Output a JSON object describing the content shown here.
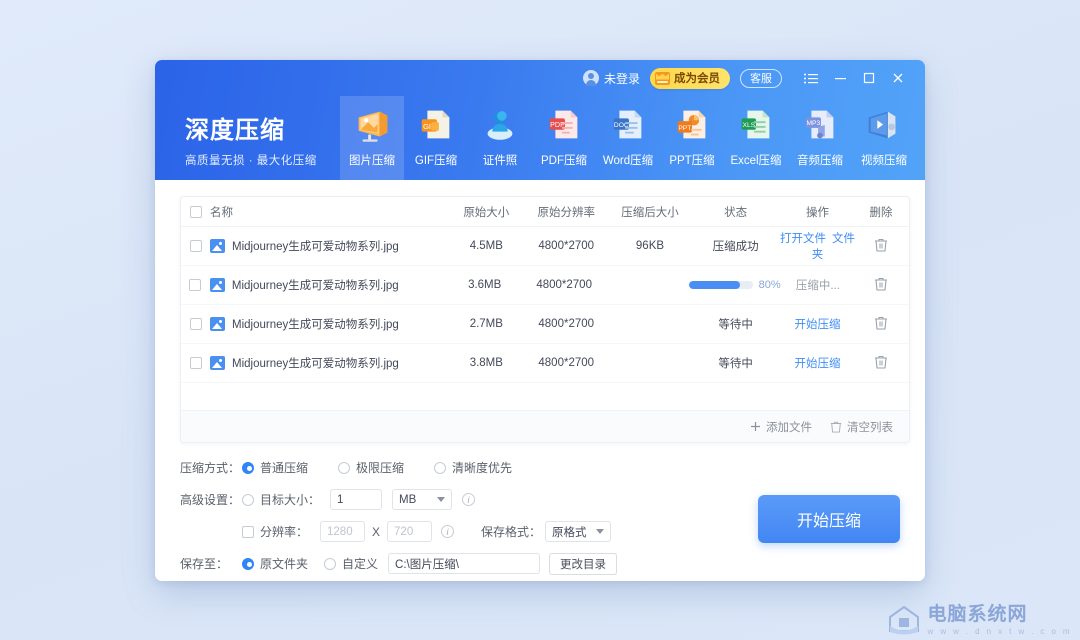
{
  "topbar": {
    "login_label": "未登录",
    "vip_label": "成为会员",
    "service_label": "客服",
    "menu_icon": "menu-list-icon",
    "minimize_icon": "minimize-icon",
    "maximize_icon": "maximize-icon",
    "close_icon": "close-icon"
  },
  "brand": {
    "title": "深度压缩",
    "subtitle": "高质量无损 · 最大化压缩"
  },
  "tabs": [
    {
      "label": "图片压缩",
      "icon": "image-compress-icon",
      "active": true
    },
    {
      "label": "GIF压缩",
      "icon": "gif-compress-icon",
      "active": false
    },
    {
      "label": "证件照",
      "icon": "id-photo-icon",
      "active": false
    },
    {
      "label": "PDF压缩",
      "icon": "pdf-compress-icon",
      "active": false
    },
    {
      "label": "Word压缩",
      "icon": "word-compress-icon",
      "active": false
    },
    {
      "label": "PPT压缩",
      "icon": "ppt-compress-icon",
      "active": false
    },
    {
      "label": "Excel压缩",
      "icon": "excel-compress-icon",
      "active": false
    },
    {
      "label": "音频压缩",
      "icon": "audio-compress-icon",
      "active": false
    },
    {
      "label": "视频压缩",
      "icon": "video-compress-icon",
      "active": false
    }
  ],
  "table": {
    "headers": {
      "name": "名称",
      "original_size": "原始大小",
      "original_resolution": "原始分辨率",
      "compressed_size": "压缩后大小",
      "status": "状态",
      "action": "操作",
      "delete": "删除"
    },
    "rows": [
      {
        "name": "Midjourney生成可爱动物系列.jpg",
        "original_size": "4.5MB",
        "resolution": "4800*2700",
        "compressed_size": "96KB",
        "status": "压缩成功",
        "action_primary": "打开文件",
        "action_secondary": "文件夹",
        "progress": null,
        "progress_text": null
      },
      {
        "name": "Midjourney生成可爱动物系列.jpg",
        "original_size": "3.6MB",
        "resolution": "4800*2700",
        "compressed_size": "",
        "status": "",
        "action_primary": "压缩中...",
        "action_secondary": "",
        "progress": 80,
        "progress_text": "80%"
      },
      {
        "name": "Midjourney生成可爱动物系列.jpg",
        "original_size": "2.7MB",
        "resolution": "4800*2700",
        "compressed_size": "",
        "status": "等待中",
        "action_primary": "开始压缩",
        "action_secondary": "",
        "progress": null,
        "progress_text": null
      },
      {
        "name": "Midjourney生成可爱动物系列.jpg",
        "original_size": "3.8MB",
        "resolution": "4800*2700",
        "compressed_size": "",
        "status": "等待中",
        "action_primary": "开始压缩",
        "action_secondary": "",
        "progress": null,
        "progress_text": null
      }
    ],
    "footer": {
      "add_files": "添加文件",
      "clear_list": "清空列表"
    }
  },
  "settings": {
    "mode_label": "压缩方式：",
    "mode_options": [
      {
        "label": "普通压缩",
        "selected": true
      },
      {
        "label": "极限压缩",
        "selected": false
      },
      {
        "label": "清晰度优先",
        "selected": false
      }
    ],
    "advanced_label": "高级设置：",
    "target_size_label": "目标大小：",
    "target_size_value": "1",
    "target_size_unit": "MB",
    "resolution_label": "分辨率：",
    "resolution_width_placeholder": "1280",
    "resolution_separator": "X",
    "resolution_height_placeholder": "720",
    "format_label": "保存格式：",
    "format_value": "原格式",
    "save_to_label": "保存至：",
    "save_original_label": "原文件夹",
    "save_custom_label": "自定义",
    "save_path": "C:\\图片压缩\\",
    "change_dir_label": "更改目录"
  },
  "start_button": "开始压缩",
  "watermark": {
    "title": "电脑系统网",
    "url": "w w w . d n x t w . c o m"
  },
  "colors": {
    "accent": "#4286f3",
    "link": "#3f8ef7",
    "vip": "#ffd84a",
    "header_from": "#2b63e8",
    "header_to": "#52a3f8"
  }
}
